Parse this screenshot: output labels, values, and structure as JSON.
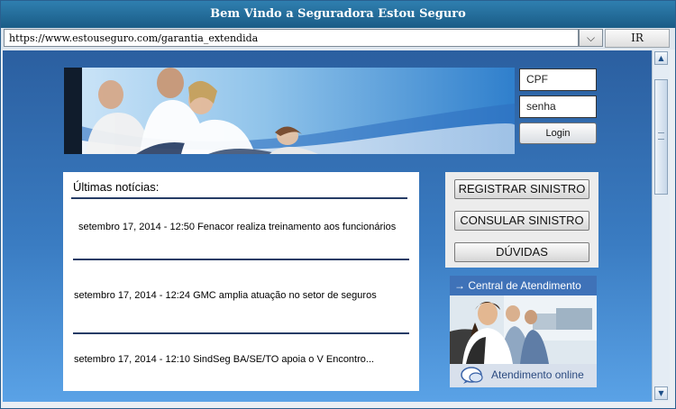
{
  "window": {
    "title": "Bem Vindo a Seguradora Estou Seguro"
  },
  "address_bar": {
    "url": "https://www.estouseguro.com/garantia_extendida",
    "go_label": "IR",
    "dropdown_glyph": "⌵"
  },
  "login": {
    "cpf_placeholder": "CPF",
    "password_placeholder": "senha",
    "button_label": "Login"
  },
  "news": {
    "heading": "Últimas notícias:",
    "items": [
      "setembro 17, 2014 - 12:50 Fenacor realiza treinamento aos funcionários",
      "setembro 17, 2014 - 12:24 GMC amplia atuação no setor de seguros",
      "setembro 17, 2014 - 12:10 SindSeg BA/SE/TO apoia o V Encontro..."
    ]
  },
  "actions": {
    "register": "REGISTRAR SINISTRO",
    "consult": "CONSULAR SINISTRO",
    "faq": "DÚVIDAS"
  },
  "support": {
    "header_arrow": "→",
    "header": "Central de Atendimento",
    "online_label": "Atendimento online"
  },
  "scrollbar": {
    "up_glyph": "▲",
    "down_glyph": "▼"
  },
  "colors": {
    "title_bar": "#1f6a96",
    "page_background_top": "#2b5fa0",
    "page_background_bottom": "#5aa2e6",
    "news_rule": "#263c66",
    "support_header": "#3f72b8"
  }
}
